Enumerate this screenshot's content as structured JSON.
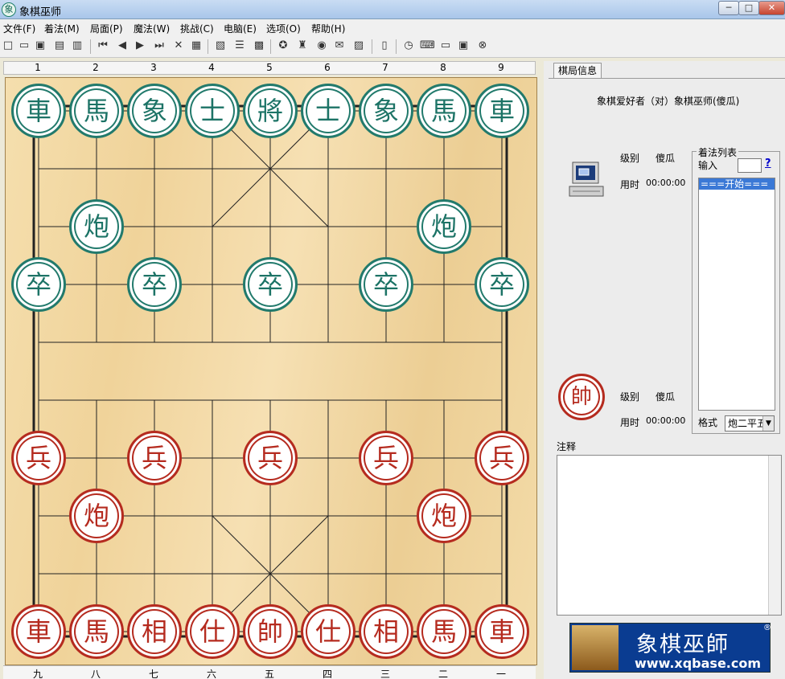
{
  "window": {
    "title": "象棋巫师",
    "app_icon": "象",
    "min": "─",
    "max": "□",
    "close": "✕"
  },
  "menu": [
    "文件(F)",
    "着法(M)",
    "局面(P)",
    "魔法(W)",
    "挑战(C)",
    "电脑(E)",
    "选项(O)",
    "帮助(H)"
  ],
  "toolbar_icons": [
    "new-file-icon",
    "open-folder-icon",
    "save-icon",
    "save-as-icon",
    "print-icon",
    "first-move-icon",
    "prev-move-icon",
    "next-move-icon",
    "last-move-icon",
    "delete-icon",
    "paste-icon",
    "copy-board-icon",
    "record-icon",
    "edit-board-icon",
    "wheel-icon",
    "analyze-icon",
    "weibo-icon",
    "online-icon",
    "clipboard-icon",
    "book-icon",
    "timer-icon",
    "computer-think-icon",
    "computer-icon",
    "monitor-icon",
    "stop-icon"
  ],
  "board": {
    "top_labels": [
      "1",
      "2",
      "3",
      "4",
      "5",
      "6",
      "7",
      "8",
      "9"
    ],
    "bottom_labels": [
      "九",
      "八",
      "七",
      "六",
      "五",
      "四",
      "三",
      "二",
      "一"
    ],
    "black_pieces": [
      {
        "ch": "車",
        "c": 0,
        "r": 0
      },
      {
        "ch": "馬",
        "c": 1,
        "r": 0
      },
      {
        "ch": "象",
        "c": 2,
        "r": 0
      },
      {
        "ch": "士",
        "c": 3,
        "r": 0
      },
      {
        "ch": "將",
        "c": 4,
        "r": 0
      },
      {
        "ch": "士",
        "c": 5,
        "r": 0
      },
      {
        "ch": "象",
        "c": 6,
        "r": 0
      },
      {
        "ch": "馬",
        "c": 7,
        "r": 0
      },
      {
        "ch": "車",
        "c": 8,
        "r": 0
      },
      {
        "ch": "炮",
        "c": 1,
        "r": 2
      },
      {
        "ch": "炮",
        "c": 7,
        "r": 2
      },
      {
        "ch": "卒",
        "c": 0,
        "r": 3
      },
      {
        "ch": "卒",
        "c": 2,
        "r": 3
      },
      {
        "ch": "卒",
        "c": 4,
        "r": 3
      },
      {
        "ch": "卒",
        "c": 6,
        "r": 3
      },
      {
        "ch": "卒",
        "c": 8,
        "r": 3
      }
    ],
    "red_pieces": [
      {
        "ch": "兵",
        "c": 0,
        "r": 6
      },
      {
        "ch": "兵",
        "c": 2,
        "r": 6
      },
      {
        "ch": "兵",
        "c": 4,
        "r": 6
      },
      {
        "ch": "兵",
        "c": 6,
        "r": 6
      },
      {
        "ch": "兵",
        "c": 8,
        "r": 6
      },
      {
        "ch": "炮",
        "c": 1,
        "r": 7
      },
      {
        "ch": "炮",
        "c": 7,
        "r": 7
      },
      {
        "ch": "車",
        "c": 0,
        "r": 9
      },
      {
        "ch": "馬",
        "c": 1,
        "r": 9
      },
      {
        "ch": "相",
        "c": 2,
        "r": 9
      },
      {
        "ch": "仕",
        "c": 3,
        "r": 9
      },
      {
        "ch": "帥",
        "c": 4,
        "r": 9
      },
      {
        "ch": "仕",
        "c": 5,
        "r": 9
      },
      {
        "ch": "相",
        "c": 6,
        "r": 9
      },
      {
        "ch": "馬",
        "c": 7,
        "r": 9
      },
      {
        "ch": "車",
        "c": 8,
        "r": 9
      }
    ]
  },
  "panel": {
    "tab": "棋局信息",
    "match_title": "象棋爱好者（对）象棋巫师(傻瓜)",
    "top_player": {
      "level_label": "级别",
      "level_value": "傻瓜",
      "time_label": "用时",
      "time_value": "00:00:00"
    },
    "bottom_player": {
      "icon": "帥",
      "level_label": "级别",
      "level_value": "傻瓜",
      "time_label": "用时",
      "time_value": "00:00:00"
    },
    "moves": {
      "title": "着法列表",
      "input_label": "输入",
      "help": "?",
      "items": [
        "===开始==="
      ],
      "format_label": "格式",
      "format_value": "炮二平五"
    },
    "notes_label": "注释",
    "banner": {
      "title": "象棋巫師",
      "url": "www.xqbase.com",
      "reg": "®"
    }
  },
  "colors": {
    "black": "#227a6c",
    "red": "#b52b1f",
    "board": "#f0d39a"
  }
}
